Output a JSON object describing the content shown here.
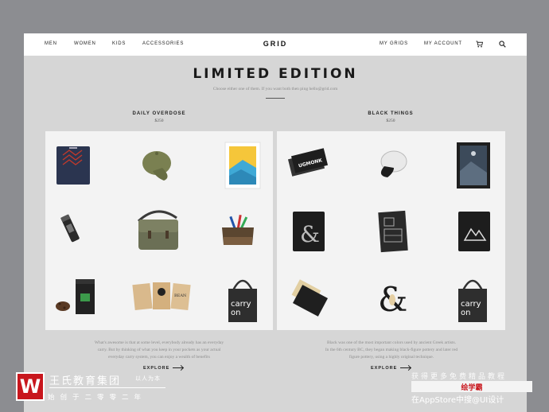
{
  "nav": {
    "left_links": [
      "MEN",
      "WOMEN",
      "KIDS",
      "ACCESSORIES"
    ],
    "logo": "GRID",
    "right_links": [
      "MY GRIDS",
      "MY ACCOUNT"
    ],
    "icons": [
      "cart-icon",
      "search-icon"
    ]
  },
  "hero": {
    "title": "LIMITED EDITION",
    "subtitle": "Choose either one of them. If you want both then ping hello@grid.com"
  },
  "collections": [
    {
      "name": "DAILY OVERDOSE",
      "price": "$250",
      "products": [
        "navy-tshirt",
        "olive-cap",
        "framed-mountain-print",
        "thermos-bottle",
        "canvas-messenger-bag",
        "tool-pouch",
        "coffee-beans",
        "coffee-bag",
        "kraft-paper-packs"
      ],
      "description_lines": [
        "What's awesome is that at some level, everybody already has an everyday",
        "carry. But by thinking of what you keep in your pockets as your actual",
        "everyday carry system, you can enjoy a wealth of benefits"
      ],
      "explore": "EXPLORE"
    },
    {
      "name": "BLACK THINGS",
      "price": "$250",
      "products": [
        "ugmonk-business-cards",
        "white-black-cap",
        "dark-mountain-print",
        "ampersand-tshirt",
        "grid-notebook",
        "mountain-tshirt",
        "leather-wallet",
        "ampersand-sculpture",
        "carry-on-tote"
      ],
      "description_lines": [
        "Black was one of the most important colors used by ancient Greek artists.",
        "In the 6th century BC, they began making black-figure pottery and later red",
        "figure pottery, using a highly original technique."
      ],
      "explore": "EXPLORE"
    }
  ],
  "tote_text": [
    "carry",
    "on"
  ],
  "card_brand": "UGMONK",
  "watermark": {
    "company": "王氏教育集团",
    "motto": "以人为本",
    "tagline": "始创于二零零二年",
    "right_top": "获得更多免费精品教程",
    "badge": "绘学霸",
    "right_bottom": "在AppStore中搜@UI设计"
  }
}
